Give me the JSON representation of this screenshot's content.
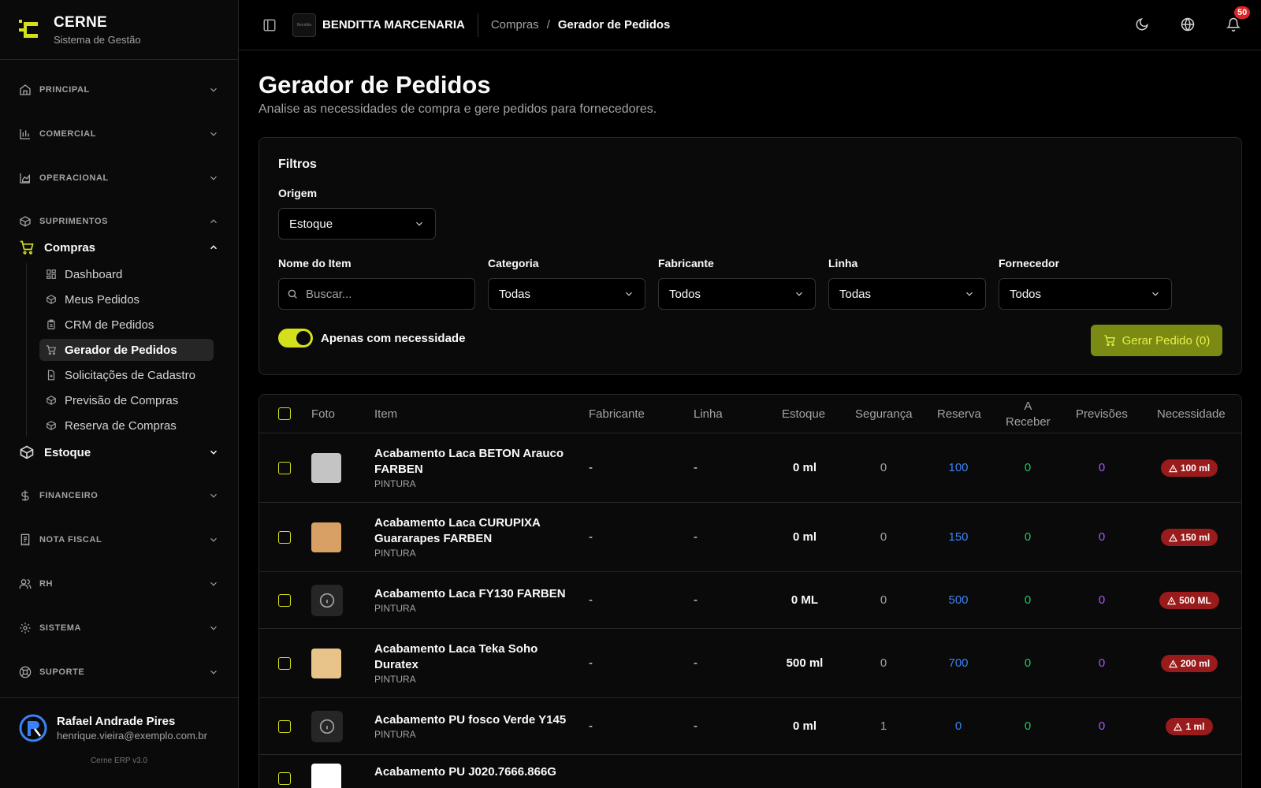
{
  "brand": {
    "name": "CERNE",
    "subtitle": "Sistema de Gestão"
  },
  "sidebar": {
    "groups_top": [
      {
        "label": "PRINCIPAL",
        "icon": "home-icon"
      },
      {
        "label": "COMERCIAL",
        "icon": "bar-chart-icon"
      },
      {
        "label": "OPERACIONAL",
        "icon": "area-chart-icon"
      }
    ],
    "suprimentos": {
      "label": "SUPRIMENTOS",
      "compras": {
        "label": "Compras",
        "items": [
          {
            "label": "Dashboard",
            "icon": "dashboard-icon"
          },
          {
            "label": "Meus Pedidos",
            "icon": "package-icon"
          },
          {
            "label": "CRM de Pedidos",
            "icon": "clipboard-icon"
          },
          {
            "label": "Gerador de Pedidos",
            "icon": "cart-icon",
            "active": true
          },
          {
            "label": "Solicitações de Cadastro",
            "icon": "file-plus-icon"
          },
          {
            "label": "Previsão de Compras",
            "icon": "package-icon"
          },
          {
            "label": "Reserva de Compras",
            "icon": "package-icon"
          }
        ]
      },
      "estoque": {
        "label": "Estoque"
      }
    },
    "groups_bottom": [
      {
        "label": "FINANCEIRO",
        "icon": "dollar-icon"
      },
      {
        "label": "NOTA FISCAL",
        "icon": "receipt-icon"
      },
      {
        "label": "RH",
        "icon": "users-icon"
      },
      {
        "label": "SISTEMA",
        "icon": "gear-icon"
      },
      {
        "label": "SUPORTE",
        "icon": "lifebuoy-icon"
      }
    ],
    "user": {
      "name": "Rafael Andrade Pires",
      "email": "henrique.vieira@exemplo.com.br"
    },
    "version": "Cerne ERP v3.0"
  },
  "topbar": {
    "company": "BENDITTA MARCENARIA",
    "breadcrumb": [
      "Compras",
      "Gerador de Pedidos"
    ],
    "separator": "/",
    "notifications": "50"
  },
  "page": {
    "title": "Gerador de Pedidos",
    "subtitle": "Analise as necessidades de compra e gere pedidos para fornecedores."
  },
  "filters": {
    "title": "Filtros",
    "origem": {
      "label": "Origem",
      "value": "Estoque"
    },
    "nome": {
      "label": "Nome do Item",
      "placeholder": "Buscar..."
    },
    "categoria": {
      "label": "Categoria",
      "value": "Todas"
    },
    "fabricante": {
      "label": "Fabricante",
      "value": "Todos"
    },
    "linha": {
      "label": "Linha",
      "value": "Todas"
    },
    "fornecedor": {
      "label": "Fornecedor",
      "value": "Todos"
    },
    "toggle_label": "Apenas com necessidade",
    "toggle_on": true,
    "generate_label": "Gerar Pedido (0)"
  },
  "table": {
    "headers": {
      "foto": "Foto",
      "item": "Item",
      "fabricante": "Fabricante",
      "linha": "Linha",
      "estoque": "Estoque",
      "seguranca": "Segurança",
      "reserva": "Reserva",
      "a_receber_1": "A",
      "a_receber_2": "Receber",
      "previsoes": "Previsões",
      "necessidade": "Necessidade"
    },
    "rows": [
      {
        "name": "Acabamento Laca BETON Arauco FARBEN",
        "category": "PINTURA",
        "fabricante": "-",
        "linha": "-",
        "estoque": "0 ml",
        "seguranca": "0",
        "reserva": "100",
        "a_receber": "0",
        "previsoes": "0",
        "necessidade": "100 ml",
        "thumb": "#c4c4c4"
      },
      {
        "name": "Acabamento Laca CURUPIXA Guararapes FARBEN",
        "category": "PINTURA",
        "fabricante": "-",
        "linha": "-",
        "estoque": "0 ml",
        "seguranca": "0",
        "reserva": "150",
        "a_receber": "0",
        "previsoes": "0",
        "necessidade": "150 ml",
        "thumb": "#d9a066"
      },
      {
        "name": "Acabamento Laca FY130 FARBEN",
        "category": "PINTURA",
        "fabricante": "-",
        "linha": "-",
        "estoque": "0 ML",
        "seguranca": "0",
        "reserva": "500",
        "a_receber": "0",
        "previsoes": "0",
        "necessidade": "500 ML",
        "thumb": ""
      },
      {
        "name": "Acabamento Laca Teka Soho Duratex",
        "category": "PINTURA",
        "fabricante": "-",
        "linha": "-",
        "estoque": "500 ml",
        "seguranca": "0",
        "reserva": "700",
        "a_receber": "0",
        "previsoes": "0",
        "necessidade": "200 ml",
        "thumb": "#e8c48a"
      },
      {
        "name": "Acabamento PU fosco Verde Y145",
        "category": "PINTURA",
        "fabricante": "-",
        "linha": "-",
        "estoque": "0 ml",
        "seguranca": "1",
        "reserva": "0",
        "a_receber": "0",
        "previsoes": "0",
        "necessidade": "1 ml",
        "thumb": ""
      },
      {
        "name": "Acabamento PU J020.7666.866G",
        "category": "",
        "fabricante": "",
        "linha": "",
        "estoque": "",
        "seguranca": "",
        "reserva": "",
        "a_receber": "",
        "previsoes": "",
        "necessidade": "",
        "thumb": "#ffffff"
      }
    ]
  },
  "colors": {
    "accent": "#d4e01c",
    "reserva": "#3b82f6",
    "a_receber": "#22c55e",
    "previsoes": "#a855f7",
    "danger": "#991b1b"
  }
}
